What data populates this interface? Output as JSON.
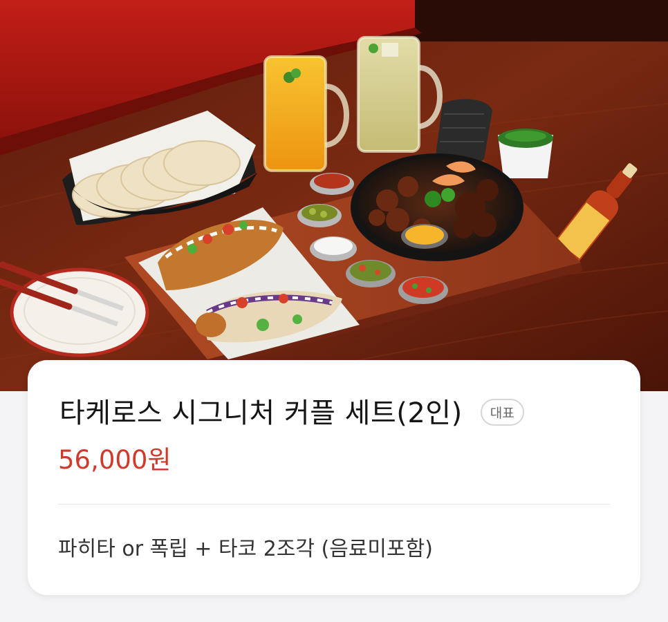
{
  "hero": {
    "image": "food-photo",
    "colors": {
      "booth": "#b01a14",
      "table": "#6a2210",
      "board": "#a84422"
    }
  },
  "menu": {
    "title": "타케로스 시그니처 커플 세트(2인)",
    "badge": "대표",
    "price": "56,000원",
    "description": "파히타 or 폭립 + 타코 2조각 (음료미포함)"
  },
  "colors": {
    "price": "#d03a2c",
    "card": "#ffffff",
    "page_background": "#f4f4f6"
  }
}
